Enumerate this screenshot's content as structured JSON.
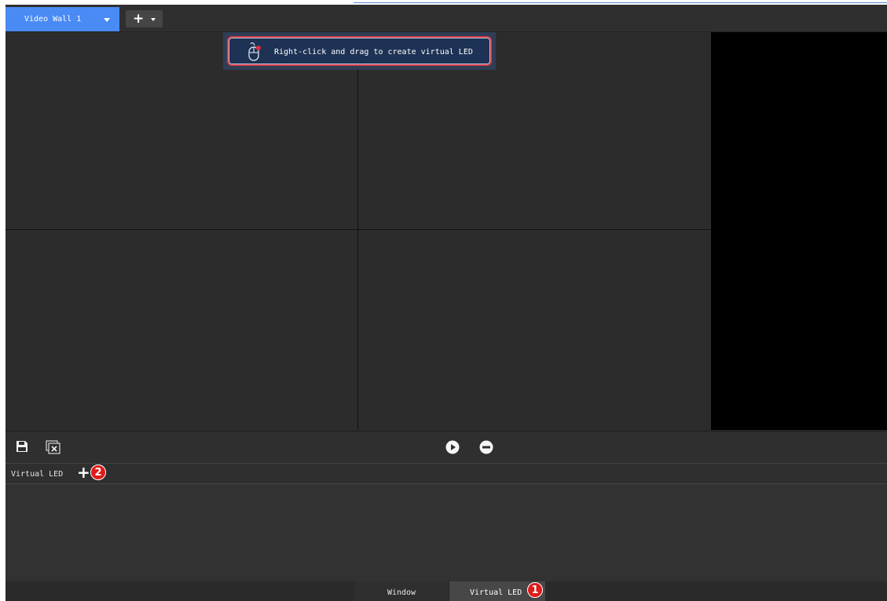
{
  "header": {
    "wall_tab_label": "Video Wall 1",
    "add_label": "+"
  },
  "hint": {
    "text": "Right-click and drag to create virtual LED"
  },
  "virtual_led": {
    "label": "Virtual LED",
    "add_label": "+"
  },
  "badges": {
    "one": "1",
    "two": "2"
  },
  "bottom_tabs": [
    {
      "label": "Window"
    },
    {
      "label": "Virtual LED"
    }
  ],
  "colors": {
    "accent": "#4a8af4",
    "background": "#2b2b2b",
    "callout": "#e01b1b"
  },
  "icons": {
    "toolbar": [
      "save-icon",
      "clear-window-icon",
      "play-icon",
      "stop-icon"
    ],
    "hint": "mouse-right-click-icon"
  }
}
